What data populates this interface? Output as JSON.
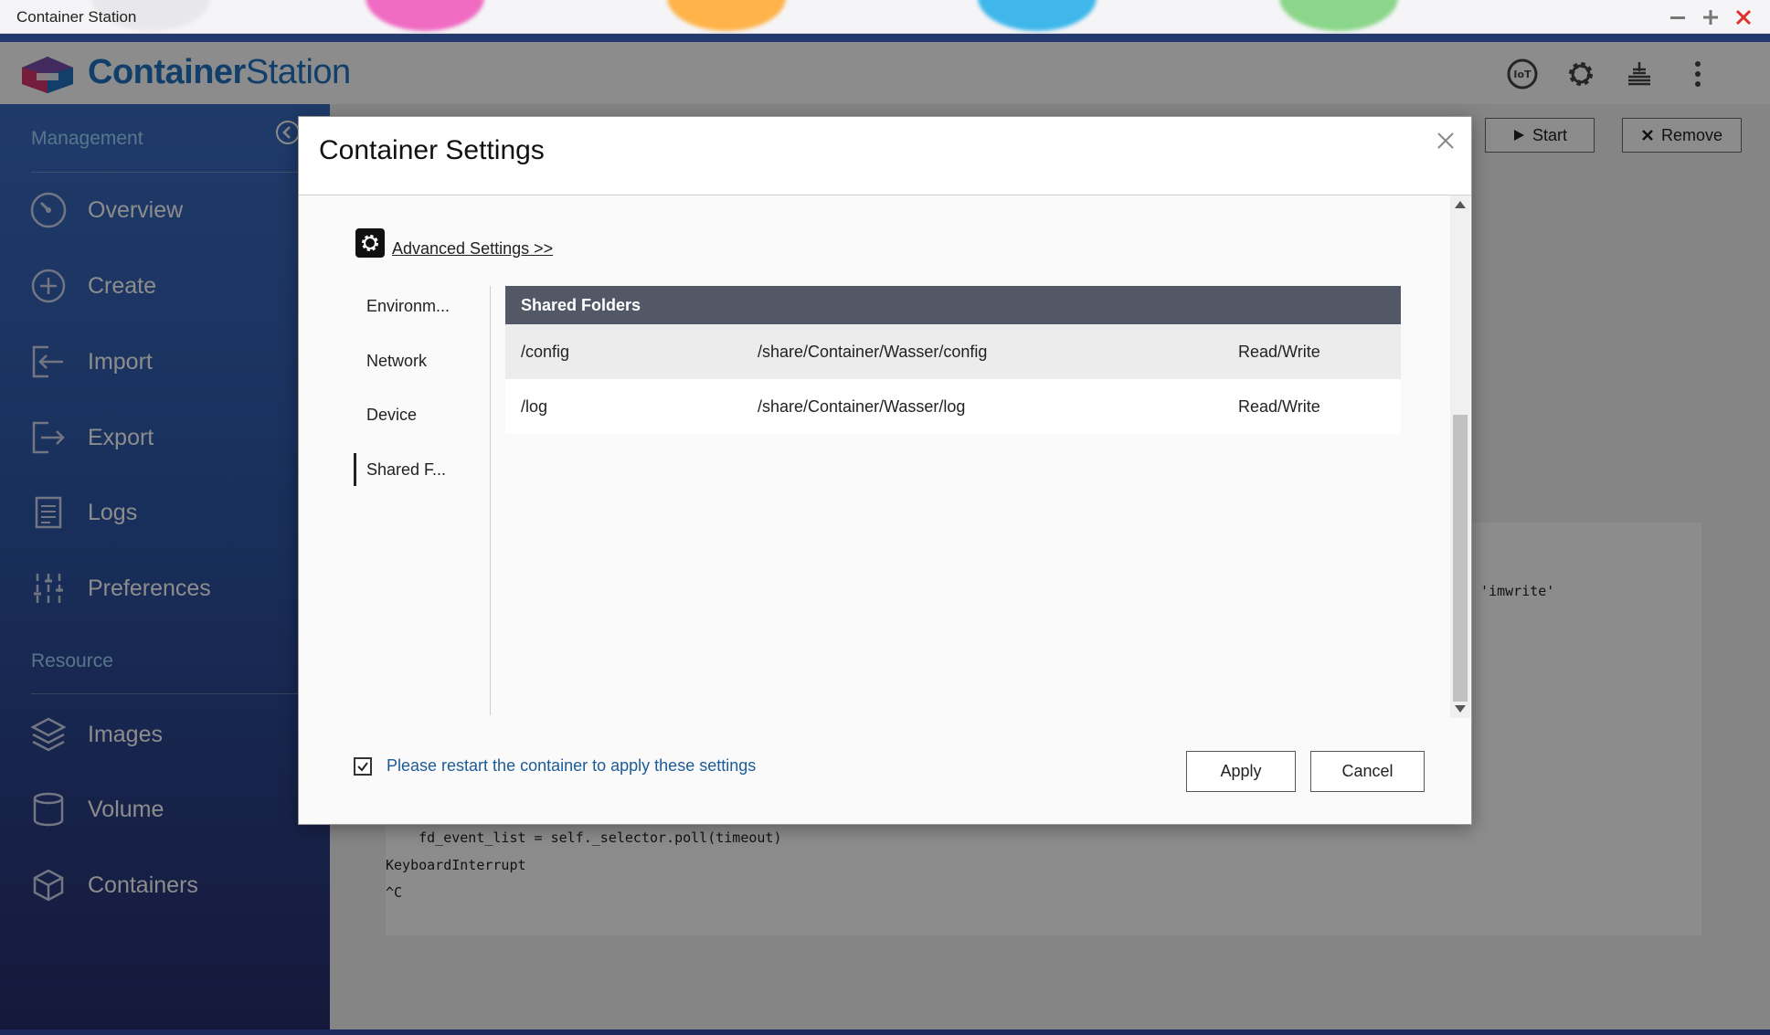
{
  "window": {
    "title": "Container Station"
  },
  "app": {
    "brand_bold": "Container",
    "brand_light": "Station"
  },
  "header_icons": [
    "iot-icon",
    "gear-icon",
    "stack-icon",
    "more-vertical-icon"
  ],
  "header_icon_text": {
    "iot": "IoT"
  },
  "sidebar": {
    "management_label": "Management",
    "resource_label": "Resource",
    "management_items": [
      {
        "label": "Overview",
        "icon": "speedometer-icon"
      },
      {
        "label": "Create",
        "icon": "plus-circle-icon"
      },
      {
        "label": "Import",
        "icon": "import-icon"
      },
      {
        "label": "Export",
        "icon": "export-icon"
      },
      {
        "label": "Logs",
        "icon": "document-icon"
      },
      {
        "label": "Preferences",
        "icon": "sliders-icon"
      }
    ],
    "resource_items": [
      {
        "label": "Images",
        "icon": "layers-icon"
      },
      {
        "label": "Volume",
        "icon": "cylinder-icon"
      },
      {
        "label": "Containers",
        "icon": "cube-icon"
      }
    ]
  },
  "toolbar": {
    "start_label": "Start",
    "remove_label": "Remove"
  },
  "console": {
    "lines": [
      "n 'imwrite'",
      "    fd_event_list = self._selector.poll(timeout)",
      "KeyboardInterrupt",
      "^C"
    ]
  },
  "modal": {
    "title": "Container Settings",
    "advanced_link": "Advanced Settings >>",
    "tabs": [
      {
        "label": "Environm..."
      },
      {
        "label": "Network"
      },
      {
        "label": "Device"
      },
      {
        "label": "Shared F..."
      }
    ],
    "active_tab": 3,
    "table_header": "Shared Folders",
    "rows": [
      {
        "container_path": "/config",
        "host_path": "/share/Container/Wasser/config",
        "mode": "Read/Write"
      },
      {
        "container_path": "/log",
        "host_path": "/share/Container/Wasser/log",
        "mode": "Read/Write"
      }
    ],
    "restart_checked": true,
    "restart_text": "Please restart the container to apply these settings",
    "apply_label": "Apply",
    "cancel_label": "Cancel"
  },
  "colors": {
    "brand_blue": "#1f74c2",
    "sidebar_top": "#3a6cc0",
    "sidebar_bottom": "#272d6b",
    "section_label": "#9fd7ff",
    "table_header_bg": "#535866",
    "restart_text": "#1c5b96",
    "close_red": "#e0302b"
  }
}
